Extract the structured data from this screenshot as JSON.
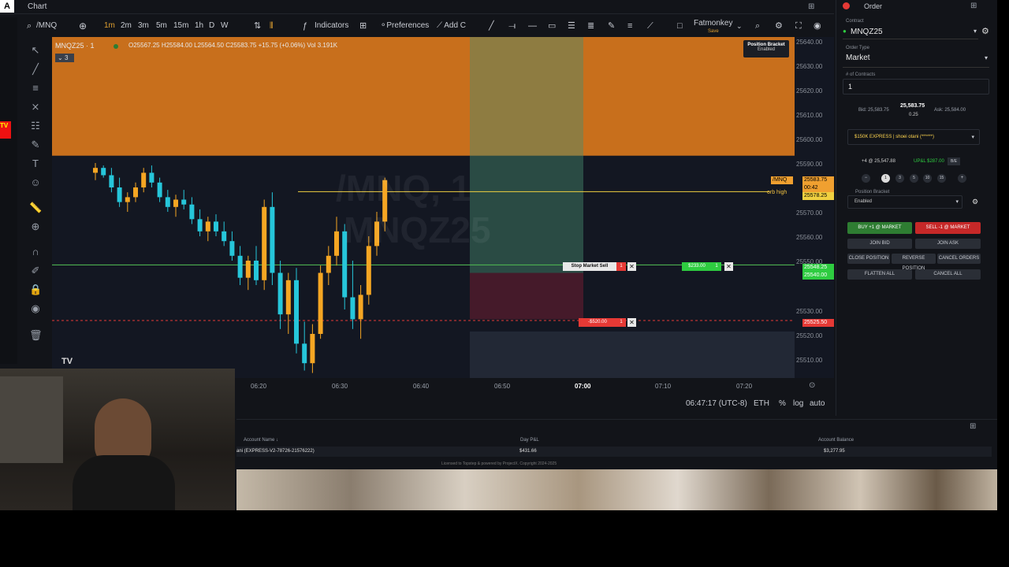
{
  "header": {
    "title": "Chart",
    "logo": "A",
    "symbol": "/MNQ",
    "timeframes": [
      "1m",
      "2m",
      "3m",
      "5m",
      "15m",
      "1h",
      "D",
      "W"
    ],
    "indicators": "Indicators",
    "preferences": "Preferences",
    "add": "Add C",
    "profile": "Fatmonkey",
    "profile_sub": "Save"
  },
  "legend": {
    "title": "MNQZ25 · 1",
    "ohlc": "O25567.25 H25584.00 L25564.50 C25583.75 +15.75 (+0.06%) Vol 3.191K",
    "count": "3"
  },
  "watermark": {
    "line1": "/MNQ, 1",
    "line2": "MNQZ25"
  },
  "position_bracket": {
    "title": "Position Bracket",
    "status": "Enabled"
  },
  "price_axis": {
    "labels": [
      "25640.00",
      "25630.00",
      "25620.00",
      "25610.00",
      "25600.00",
      "25590.00",
      "25570.00",
      "25560.00",
      "25550.00",
      "25530.00",
      "25520.00",
      "25510.00"
    ],
    "tag_mnq": "/MNQ",
    "tag_last": "25583.75",
    "tag_timer": "00:42",
    "tag_orb": "25578.25",
    "tag_entry": "25548.25",
    "tag_entry2": "25540.00",
    "tag_stop": "25525.50"
  },
  "time_axis": {
    "labels": [
      "06:20",
      "06:30",
      "06:40",
      "06:50",
      "07:00",
      "07:10",
      "07:20"
    ],
    "clock": "06:47:17 (UTC-8)",
    "session": "ETH",
    "pct": "%",
    "log": "log",
    "auto": "auto"
  },
  "orb_label": "orb high",
  "orders": {
    "stop_label": "Stop Market Sell",
    "stop_qty": "1",
    "profit_label": "$233.00",
    "profit_qty": "1",
    "stop_loss_label": "-$520.00",
    "stop_loss_qty": "1"
  },
  "order_panel": {
    "title": "Order",
    "contract_label": "Contract",
    "contract": "MNQZ25",
    "type_label": "Order Type",
    "type": "Market",
    "contracts_label": "# of Contracts",
    "contracts": "1",
    "bid": "Bid: 25,583.75",
    "last": "25,583.75",
    "spread": "0.25",
    "ask": "Ask: 25,584.00",
    "account": "$150K EXPRESS | shoei otani (******)",
    "position": "+4 @ 25,547.88",
    "upnl": "UP&L $287.00",
    "be": "B/E",
    "qty_btns": [
      "1",
      "3",
      "5",
      "10",
      "15"
    ],
    "bracket_label": "Position Bracket",
    "bracket": "Enabled",
    "buy": "BUY +1 @ MARKET",
    "sell": "SELL -1 @ MARKET",
    "join_bid": "JOIN BID",
    "join_ask": "JOIN ASK",
    "close": "CLOSE POSITION",
    "reverse": "REVERSE POSITION",
    "cancel_orders": "CANCEL ORDERS",
    "flatten": "FLATTEN ALL",
    "cancel_all": "CANCEL ALL",
    "buy_color": "#2e7d32",
    "sell_color": "#c62828"
  },
  "accounts": {
    "col_name": "Account Name",
    "col_pnl": "Day P&L",
    "col_balance": "Account Balance",
    "name": "ani (EXPRESS-V2-78726-21576222)",
    "pnl": "$431.66",
    "balance": "$3,277.95",
    "license": "Licensed to Topstep & powered by ProjectX. Copyright 2024-2025"
  }
}
